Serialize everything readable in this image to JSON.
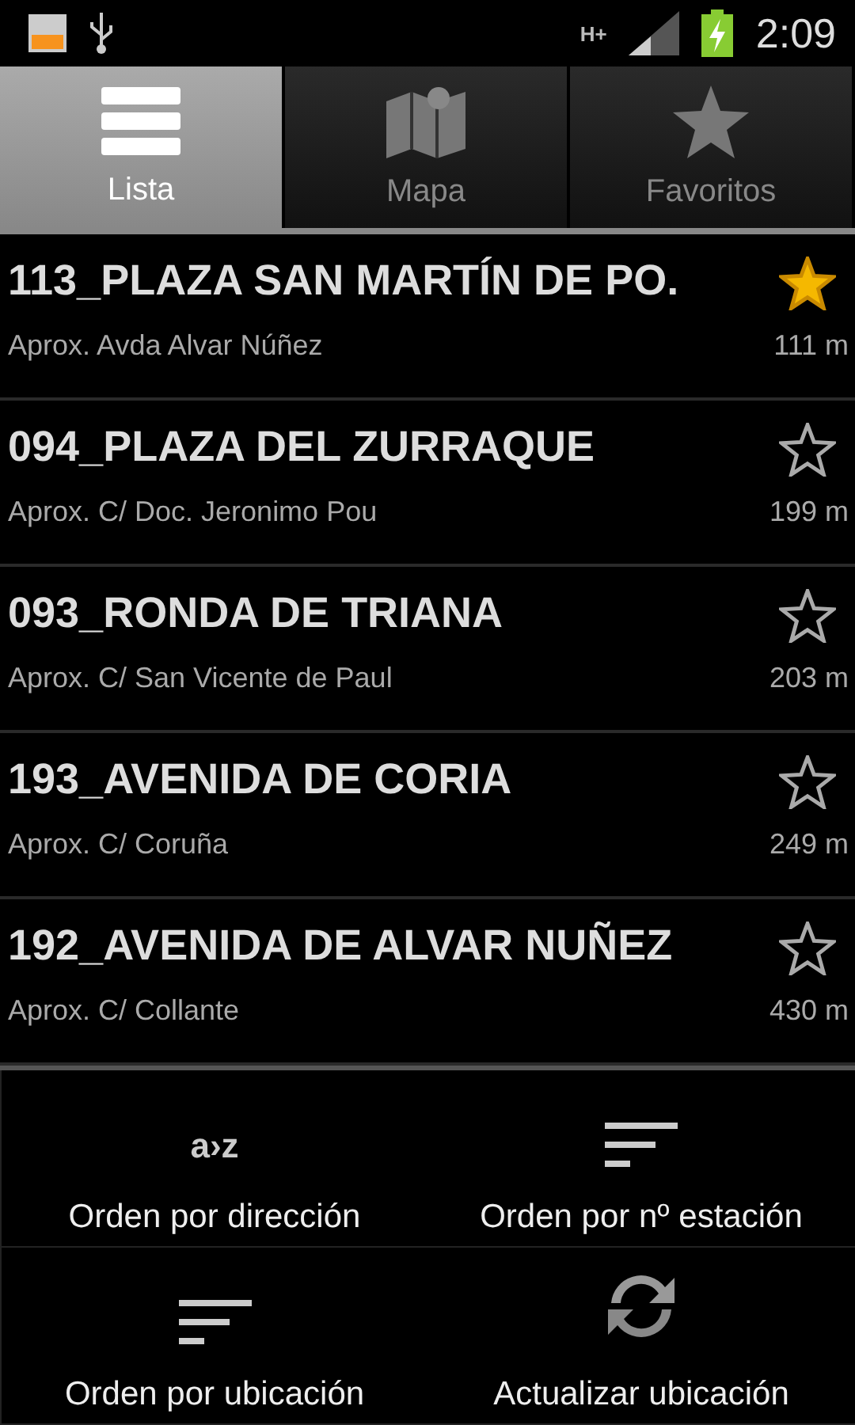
{
  "status_bar": {
    "network": "H+",
    "time": "2:09"
  },
  "tabs": [
    {
      "label": "Lista",
      "kind": "list",
      "selected": true
    },
    {
      "label": "Mapa",
      "kind": "map",
      "selected": false
    },
    {
      "label": "Favoritos",
      "kind": "star",
      "selected": false
    }
  ],
  "stations": [
    {
      "name": "113_PLAZA SAN MARTÍN DE PO.",
      "address": "Aprox. Avda Alvar Núñez",
      "distance": "111 m",
      "favorite": true
    },
    {
      "name": "094_PLAZA DEL ZURRAQUE",
      "address": "Aprox. C/ Doc. Jeronimo Pou",
      "distance": "199 m",
      "favorite": false
    },
    {
      "name": "093_RONDA DE TRIANA",
      "address": "Aprox. C/ San Vicente de Paul",
      "distance": "203 m",
      "favorite": false
    },
    {
      "name": "193_AVENIDA DE CORIA",
      "address": "Aprox. C/ Coruña",
      "distance": "249 m",
      "favorite": false
    },
    {
      "name": "192_AVENIDA DE ALVAR NUÑEZ",
      "address": "Aprox. C/ Collante",
      "distance": "430 m",
      "favorite": false
    }
  ],
  "menu": [
    {
      "label": "Orden por dirección",
      "kind": "az",
      "icon_text": "a›z"
    },
    {
      "label": "Orden por nº estación",
      "kind": "sort"
    },
    {
      "label": "Orden por ubicación",
      "kind": "sort"
    },
    {
      "label": "Actualizar ubicación",
      "kind": "refresh"
    }
  ]
}
